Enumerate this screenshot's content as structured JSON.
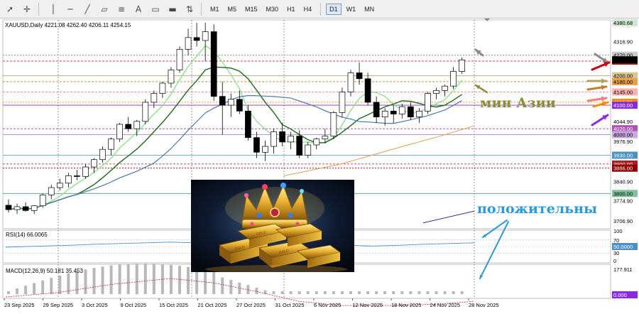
{
  "toolbar": {
    "timeframes": [
      "M1",
      "M5",
      "M15",
      "M30",
      "H1",
      "H4",
      "D1",
      "W1",
      "MN"
    ],
    "active_timeframe": "D1",
    "icons": [
      "cursor-icon",
      "crosshair-icon",
      "vertical-line-icon",
      "horizontal-line-icon",
      "trendline-icon",
      "channel-icon",
      "fibonacci-icon",
      "text-icon",
      "label-icon",
      "shapes-icon",
      "arrows-icon"
    ]
  },
  "chart": {
    "symbol_info": "XAUUSD,Daily  4221.08 4262.40 4206.11 4254.15",
    "rsi_label": "RSI(14) 66.0065",
    "macd_label": "MACD(12,26,9) 50.181 35.453",
    "price_scale": [
      "4380.68",
      "4316.90",
      "4270.00",
      "4250.00",
      "4200.00",
      "4180.00",
      "4145.00",
      "4110.00",
      "4100.00",
      "4044.90",
      "4020.00",
      "4000.00",
      "3976.90",
      "3930.00",
      "3900.00",
      "3886.00",
      "3840.90",
      "3800.00",
      "3774.90",
      "3706.90"
    ],
    "rsi_scale": [
      "100",
      "70",
      "50.0000",
      "30",
      "0"
    ],
    "macd_scale": [
      "177.911",
      "0.000"
    ],
    "date_axis": [
      "23 Sep 2025",
      "29 Sep 2025",
      "3 Oct 2025",
      "9 Oct 2025",
      "15 Oct 2025",
      "21 Oct 2025",
      "27 Oct 2025",
      "31 Oct 2025",
      "6 Nov 2025",
      "12 Nov 2025",
      "18 Nov 2025",
      "24 Nov 2025",
      "28 Nov 2025"
    ],
    "colors": {
      "bull": "#ffffff",
      "bear": "#000000",
      "ma_fast": "#90e090",
      "ma_mid": "#1a6a1a",
      "ma_slow": "#4a78b0",
      "ma_long": "#e0a050",
      "level_4250": "#cc0000",
      "level_4200": "#b0a060",
      "level_4180": "#c08030",
      "level_4145": "#f08080",
      "level_4110": "#ff8c00",
      "level_4100": "#8a2be2",
      "level_4020": "#a040a0",
      "level_3930": "#4a90c0",
      "level_3886": "#8b0000",
      "level_3800": "#40a080"
    }
  },
  "annotations": {
    "asia_min": "мин Азии",
    "positive": "положительны"
  },
  "promo_image": {
    "description_icon": "gold-bars-crown-image",
    "bar_text": "GOLD"
  }
}
